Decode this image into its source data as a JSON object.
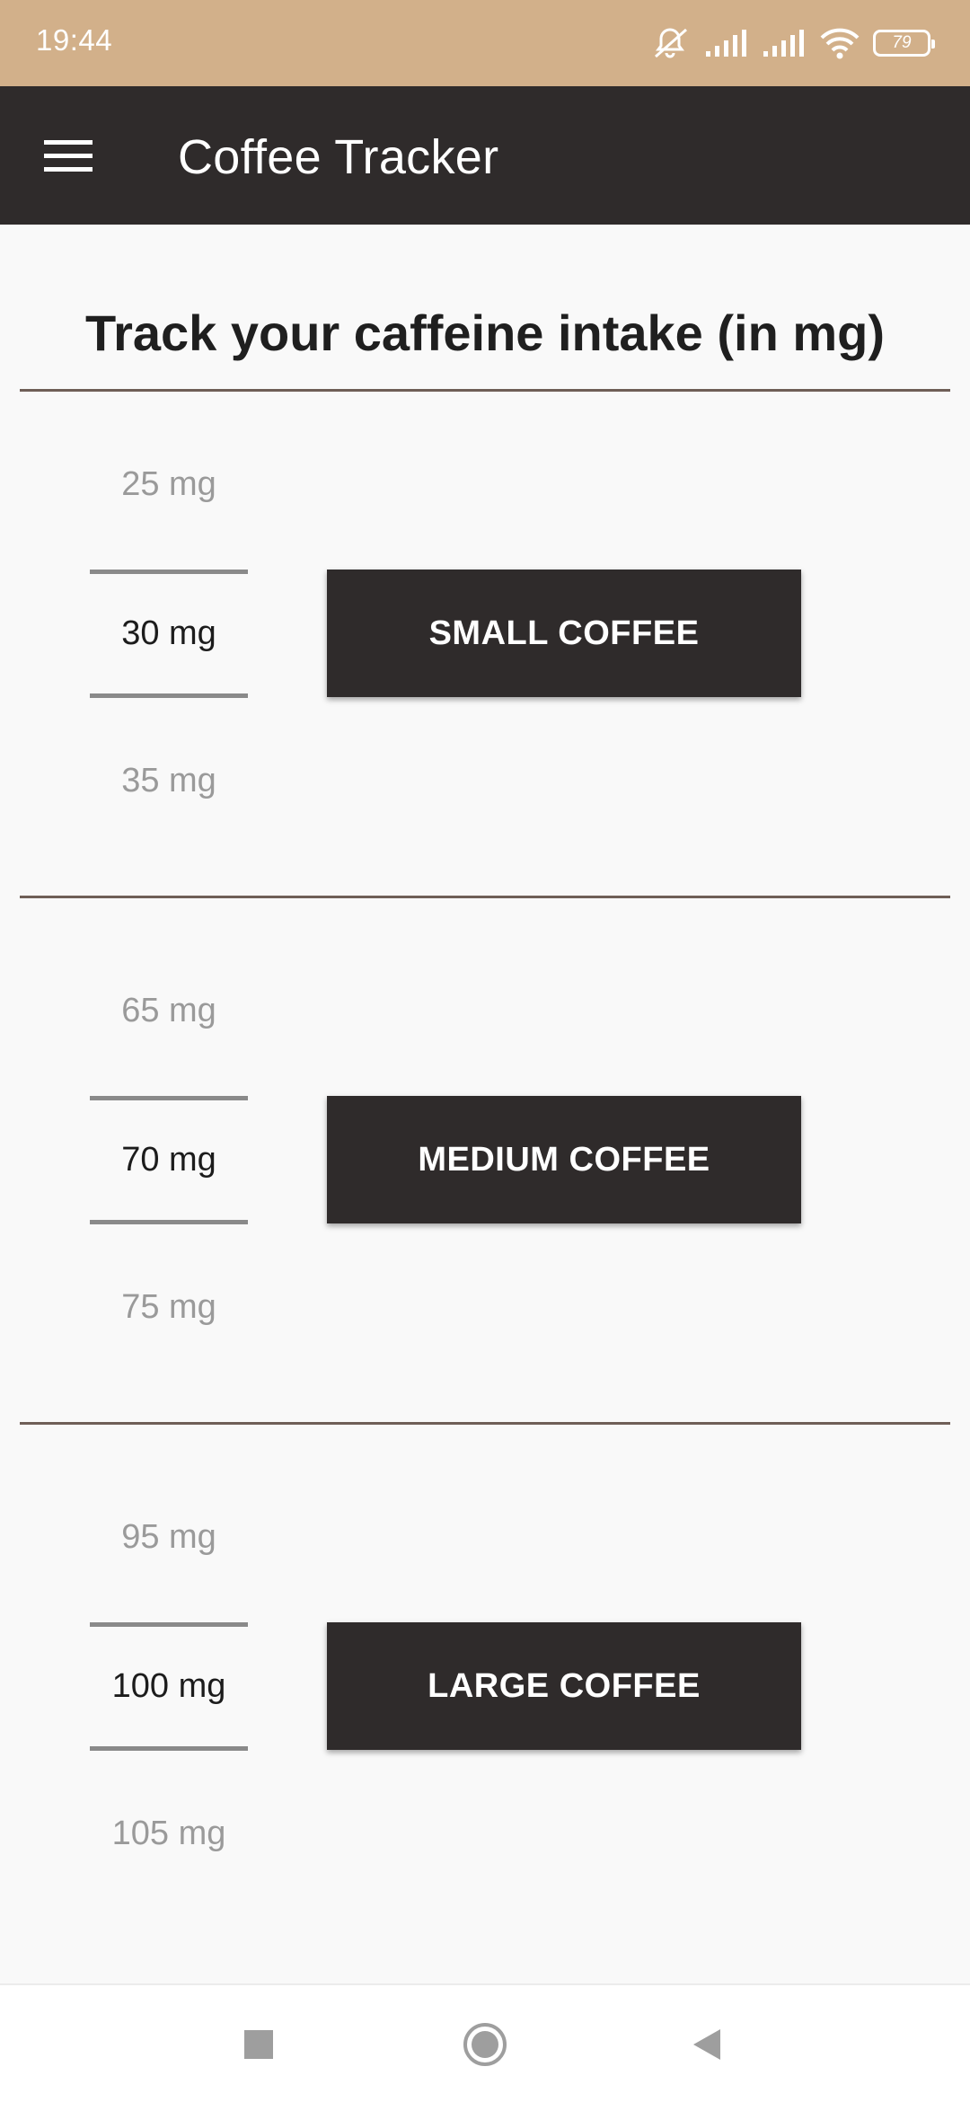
{
  "status_bar": {
    "time": "19:44",
    "battery": "79",
    "icons": [
      "mute-icon",
      "signal-icon",
      "signal-icon",
      "wifi-icon",
      "battery-icon"
    ]
  },
  "app_bar": {
    "title": "Coffee Tracker",
    "menu_icon": "menu-icon"
  },
  "heading": "Track your caffeine intake (in mg)",
  "sections": [
    {
      "above": "25 mg",
      "selected": "30 mg",
      "below": "35 mg",
      "button": "SMALL COFFEE"
    },
    {
      "above": "65 mg",
      "selected": "70 mg",
      "below": "75 mg",
      "button": "MEDIUM COFFEE"
    },
    {
      "above": "95 mg",
      "selected": "100 mg",
      "below": "105 mg",
      "button": "LARGE COFFEE"
    }
  ],
  "nav_bar": {
    "icons": [
      "recents-icon",
      "home-icon",
      "back-icon"
    ]
  },
  "colors": {
    "status_bar": "#d2b08a",
    "app_bar": "#2f2b2b",
    "button": "#2f2b2b",
    "background": "#f9f9f9",
    "divider": "#6f5f57"
  }
}
